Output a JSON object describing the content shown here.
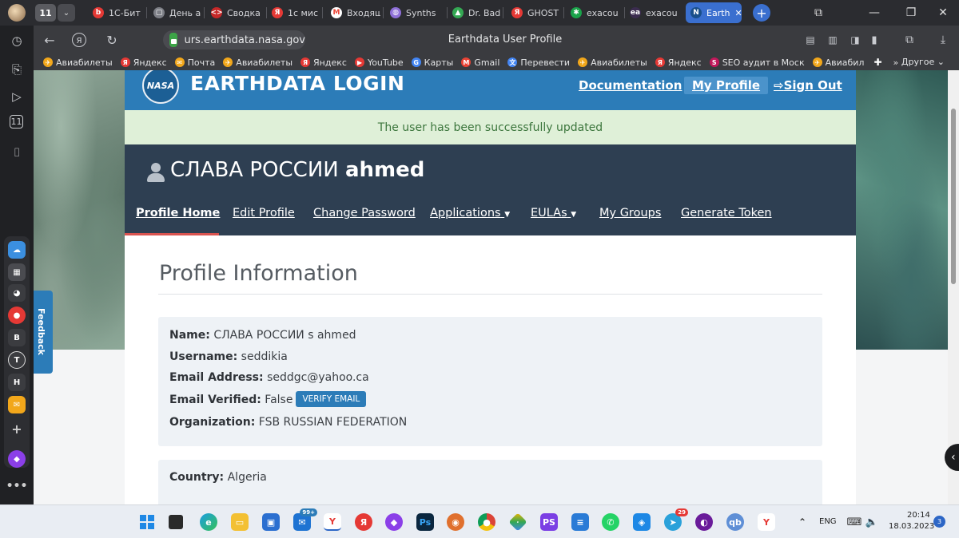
{
  "browser": {
    "tab_counter": "11",
    "tabs": [
      {
        "label": "1С-Бит",
        "color": "#e53935",
        "glyph": "b"
      },
      {
        "label": "День a",
        "color": "#7d7f86",
        "glyph": "▢"
      },
      {
        "label": "Сводка",
        "color": "#c62828",
        "glyph": "<>"
      },
      {
        "label": "1с мис",
        "color": "#e53935",
        "glyph": "Я"
      },
      {
        "label": "Входящ",
        "color": "#ffffff",
        "glyph": "M"
      },
      {
        "label": "Synths",
        "color": "#8e6fd8",
        "glyph": "◍"
      },
      {
        "label": "Dr. Bad",
        "color": "#34a853",
        "glyph": "▲"
      },
      {
        "label": "GHOST",
        "color": "#e53935",
        "glyph": "Я"
      },
      {
        "label": "exacou",
        "color": "#1aa34a",
        "glyph": "✱"
      },
      {
        "label": "exacou",
        "color": "#3b2c4f",
        "glyph": "ea"
      },
      {
        "label": "Earth",
        "color": "#1a4f8a",
        "glyph": "N"
      }
    ],
    "url": "urs.earthdata.nasa.gov",
    "page_title": "Earthdata User Profile",
    "bookmarks": [
      {
        "label": "Авиабилеты",
        "color": "#f2a71b",
        "glyph": "✈"
      },
      {
        "label": "Яндекс",
        "color": "#e53935",
        "glyph": "Я"
      },
      {
        "label": "Почта",
        "color": "#f2a71b",
        "glyph": "✉"
      },
      {
        "label": "Авиабилеты",
        "color": "#f2a71b",
        "glyph": "✈"
      },
      {
        "label": "Яндекс",
        "color": "#e53935",
        "glyph": "Я"
      },
      {
        "label": "YouTube",
        "color": "#e53935",
        "glyph": "▶"
      },
      {
        "label": "Карты",
        "color": "#4285f4",
        "glyph": "G"
      },
      {
        "label": "Gmail",
        "color": "#ea4335",
        "glyph": "M"
      },
      {
        "label": "Перевести",
        "color": "#4285f4",
        "glyph": "文"
      },
      {
        "label": "Авиабилеты",
        "color": "#f2a71b",
        "glyph": "✈"
      },
      {
        "label": "Яндекс",
        "color": "#e53935",
        "glyph": "Я"
      },
      {
        "label": "SEO аудит в Моск",
        "color": "#c2185b",
        "glyph": "S"
      },
      {
        "label": "Авиабил",
        "color": "#f2a71b",
        "glyph": "✈"
      }
    ],
    "bookmarks_more": "Другое"
  },
  "site": {
    "logo_text": "NASA",
    "brand": "EARTHDATA LOGIN",
    "nav": {
      "documentation": "Documentation",
      "my_profile": "My Profile",
      "sign_out": "Sign Out"
    },
    "alert": "The user has been successfully updated",
    "user": {
      "display_name": "СЛАВА РОССИИ",
      "last_name": "ahmed"
    },
    "subnav": {
      "profile_home": "Profile Home",
      "edit_profile": "Edit Profile",
      "change_password": "Change Password",
      "applications": "Applications",
      "eulas": "EULAs",
      "my_groups": "My Groups",
      "generate_token": "Generate Token"
    },
    "profile": {
      "heading": "Profile Information",
      "name_label": "Name:",
      "name_value": "СЛАВА РОССИИ s ahmed",
      "username_label": "Username:",
      "username_value": "seddikia",
      "email_label": "Email Address:",
      "email_value": "seddgc@yahoo.ca",
      "verified_label": "Email Verified:",
      "verified_value": "False",
      "verify_button": "VERIFY EMAIL",
      "org_label": "Organization:",
      "org_value": "FSB RUSSIAN FEDERATION",
      "country_label": "Country:",
      "country_value": "Algeria"
    },
    "feedback": "Feedback"
  },
  "taskbar": {
    "mail_badge": "99+",
    "notif_badge": "29",
    "language": "ENG",
    "time": "20:14",
    "date": "18.03.2023",
    "notification_count": "3"
  }
}
